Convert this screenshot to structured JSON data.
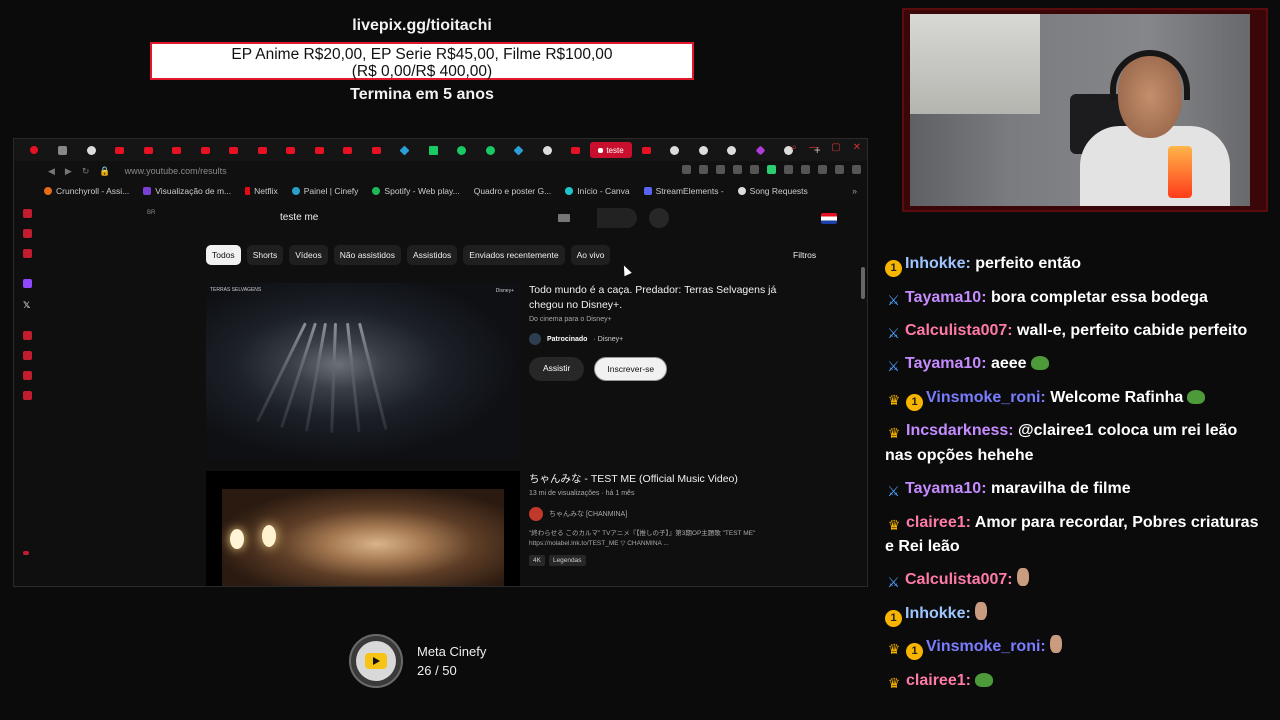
{
  "donation": {
    "link": "livepix.gg/tioitachi",
    "prices_line1": "EP Anime R$20,00, EP Serie R$45,00, Filme R$100,00",
    "prices_line2": "(R$ 0,00/R$ 400,00)",
    "ends": "Termina em 5 anos"
  },
  "browser": {
    "active_tab_label": "teste",
    "url": "www.youtube.com/results",
    "bookmarks": [
      {
        "label": "Crunchyroll - Assi..."
      },
      {
        "label": "Visualização de m..."
      },
      {
        "label": "Netflix"
      },
      {
        "label": "Painel | Cinefy"
      },
      {
        "label": "Spotify - Web play..."
      },
      {
        "label": "Quadro e poster G..."
      },
      {
        "label": "Início - Canva"
      },
      {
        "label": "StreamElements -"
      },
      {
        "label": "Song Requests"
      }
    ]
  },
  "youtube": {
    "region": "BR",
    "search_query": "teste me",
    "chips": [
      "Todos",
      "Shorts",
      "Vídeos",
      "Não assistidos",
      "Assistidos",
      "Enviados recentemente",
      "Ao vivo"
    ],
    "filters_label": "Filtros",
    "ad": {
      "brand_left": "TERRAS SELVAGENS",
      "brand_right": "Disney+",
      "title": "Todo mundo é a caça. Predador: Terras Selvagens já chegou no Disney+.",
      "subtitle": "Do cinema para o Disney+",
      "sponsored": "Patrocinado",
      "sponsor_name": "· Disney+",
      "watch_btn": "Assistir",
      "subscribe_btn": "Inscrever-se"
    },
    "video": {
      "title": "ちゃんみな - TEST ME (Official Music Video)",
      "meta": "13 mi de visualizações · há 1 mês",
      "channel": "ちゃんみな [CHANMINA]",
      "desc_line1": "\"終わらせる このカルマ\" TVアニメ『【推しの子】』第3期OP主題歌 \"TEST ME\"",
      "desc_line2": "https://nolabel.lnk.to/TEST_ME ▽ CHANMINA ...",
      "badges": [
        "4K",
        "Legendas"
      ]
    }
  },
  "meta_widget": {
    "title": "Meta Cinefy",
    "progress_text": "26 / 50",
    "current": 26,
    "goal": 50
  },
  "chat": [
    {
      "badge": "sub",
      "name": "Inhokke:",
      "color": "#9fc5ff",
      "text": "perfeito então",
      "emote": ""
    },
    {
      "badge": "sword",
      "name": "Tayama10:",
      "color": "#c58cff",
      "text": "bora completar essa bodega",
      "emote": ""
    },
    {
      "badge": "sword",
      "name": "Calculista007:",
      "color": "#ff7aa8",
      "text": "wall-e, perfeito cabide perfeito",
      "emote": ""
    },
    {
      "badge": "sword",
      "name": "Tayama10:",
      "color": "#c58cff",
      "text": "aeee",
      "emote": "pepe"
    },
    {
      "badge": "crown-sub",
      "name": "Vinsmoke_roni:",
      "color": "#7a7dff",
      "text": "Welcome Rafinha",
      "emote": "pepe"
    },
    {
      "badge": "crown",
      "name": "Incsdarkness:",
      "color": "#c58cff",
      "text": "@clairee1 coloca um rei leão nas opções hehehe",
      "emote": ""
    },
    {
      "badge": "sword",
      "name": "Tayama10:",
      "color": "#c58cff",
      "text": "maravilha de filme",
      "emote": ""
    },
    {
      "badge": "crown",
      "name": "clairee1:",
      "color": "#ff7aa8",
      "text": "Amor para recordar, Pobres criaturas e Rei leão",
      "emote": ""
    },
    {
      "badge": "sword",
      "name": "Calculista007:",
      "color": "#ff7aa8",
      "text": "",
      "emote": "hand"
    },
    {
      "badge": "sub",
      "name": "Inhokke:",
      "color": "#9fc5ff",
      "text": "",
      "emote": "hand"
    },
    {
      "badge": "crown-sub",
      "name": "Vinsmoke_roni:",
      "color": "#7a7dff",
      "text": "",
      "emote": "hand"
    },
    {
      "badge": "crown",
      "name": "clairee1:",
      "color": "#ff7aa8",
      "text": "",
      "emote": "pepe"
    }
  ]
}
